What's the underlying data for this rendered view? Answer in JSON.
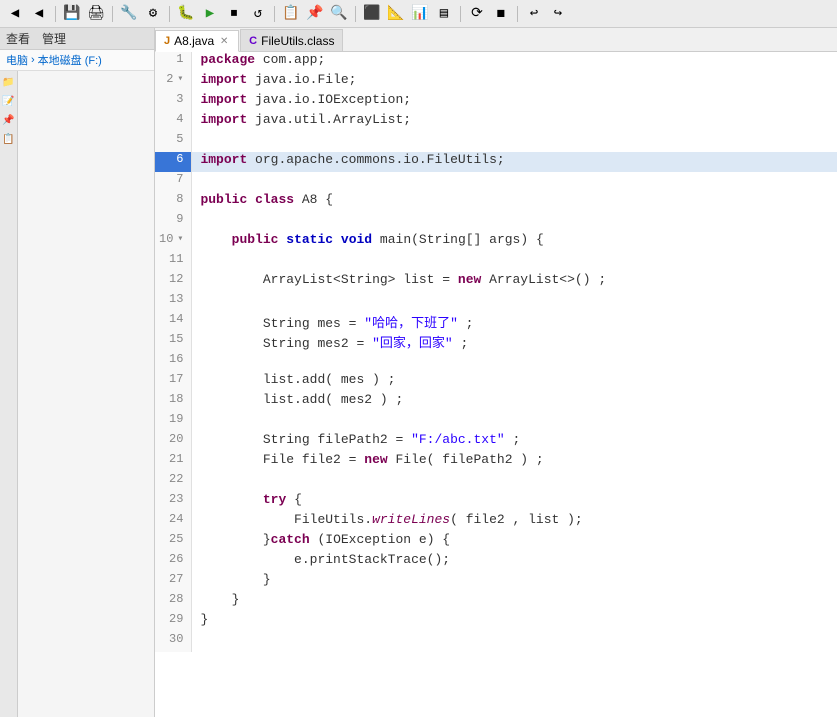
{
  "toolbar": {
    "buttons": [
      "◀",
      "◀◀",
      "💾",
      "🖨",
      "🔧",
      "⚙",
      "🐛",
      "▶",
      "⏹",
      "↺",
      "📋",
      "📌",
      "🔍",
      "⬛",
      "📐",
      "📊",
      "▤",
      "⟳",
      "◼",
      "↩",
      "↪"
    ]
  },
  "left_panel": {
    "menu_items": [
      "查看",
      "管理"
    ],
    "breadcrumb": [
      "电脑",
      "本地磁盘 (F:)"
    ]
  },
  "tabs": [
    {
      "id": "a8",
      "label": "A8.java",
      "icon": "J",
      "active": true,
      "closeable": true
    },
    {
      "id": "fileutils",
      "label": "FileUtils.class",
      "icon": "C",
      "active": false,
      "closeable": false
    }
  ],
  "code_lines": [
    {
      "num": "1",
      "content": "package com.app;",
      "highlighted": false,
      "fold": false,
      "parts": [
        {
          "type": "kw",
          "text": "package"
        },
        {
          "type": "plain",
          "text": " com.app;"
        }
      ]
    },
    {
      "num": "2",
      "content": "import java.io.File;",
      "highlighted": false,
      "fold": true,
      "parts": [
        {
          "type": "kw",
          "text": "import"
        },
        {
          "type": "plain",
          "text": " java.io.File;"
        }
      ]
    },
    {
      "num": "3",
      "content": "import java.io.IOException;",
      "highlighted": false,
      "fold": false,
      "parts": [
        {
          "type": "kw",
          "text": "import"
        },
        {
          "type": "plain",
          "text": " java.io.IOException;"
        }
      ]
    },
    {
      "num": "4",
      "content": "import java.util.ArrayList;",
      "highlighted": false,
      "fold": false,
      "parts": [
        {
          "type": "kw",
          "text": "import"
        },
        {
          "type": "plain",
          "text": " java.util.ArrayList;"
        }
      ]
    },
    {
      "num": "5",
      "content": "",
      "highlighted": false,
      "fold": false,
      "parts": []
    },
    {
      "num": "6",
      "content": "import org.apache.commons.io.FileUtils;",
      "highlighted": true,
      "fold": false,
      "parts": [
        {
          "type": "kw",
          "text": "import"
        },
        {
          "type": "plain",
          "text": " org.apache.commons.io.FileUtils;"
        }
      ]
    },
    {
      "num": "7",
      "content": "",
      "highlighted": false,
      "fold": false,
      "parts": []
    },
    {
      "num": "8",
      "content": "public class A8 {",
      "highlighted": false,
      "fold": false,
      "parts": [
        {
          "type": "kw",
          "text": "public"
        },
        {
          "type": "plain",
          "text": " "
        },
        {
          "type": "kw",
          "text": "class"
        },
        {
          "type": "plain",
          "text": " A8 {"
        }
      ]
    },
    {
      "num": "9",
      "content": "",
      "highlighted": false,
      "fold": false,
      "parts": []
    },
    {
      "num": "10",
      "content": "    public static void main(String[] args) {",
      "highlighted": false,
      "fold": true,
      "parts": [
        {
          "type": "plain",
          "text": "    "
        },
        {
          "type": "kw",
          "text": "public"
        },
        {
          "type": "plain",
          "text": " "
        },
        {
          "type": "kw2",
          "text": "static"
        },
        {
          "type": "plain",
          "text": " "
        },
        {
          "type": "kw2",
          "text": "void"
        },
        {
          "type": "plain",
          "text": " main(String[] args) {"
        }
      ]
    },
    {
      "num": "11",
      "content": "",
      "highlighted": false,
      "fold": false,
      "parts": []
    },
    {
      "num": "12",
      "content": "        ArrayList<String> list = new ArrayList<>();",
      "highlighted": false,
      "fold": false,
      "parts": [
        {
          "type": "plain",
          "text": "        ArrayList<String> list = "
        },
        {
          "type": "kw",
          "text": "new"
        },
        {
          "type": "plain",
          "text": " ArrayList<>() ;"
        }
      ]
    },
    {
      "num": "13",
      "content": "",
      "highlighted": false,
      "fold": false,
      "parts": []
    },
    {
      "num": "14",
      "content": "        String mes = \"哈哈，下班了\" ;",
      "highlighted": false,
      "fold": false,
      "parts": [
        {
          "type": "plain",
          "text": "        String mes = "
        },
        {
          "type": "str",
          "text": "\"哈哈，下班了\""
        },
        {
          "type": "plain",
          "text": " ;"
        }
      ]
    },
    {
      "num": "15",
      "content": "        String mes2 = \"回家，回家\" ;",
      "highlighted": false,
      "fold": false,
      "parts": [
        {
          "type": "plain",
          "text": "        String mes2 = "
        },
        {
          "type": "str",
          "text": "\"回家，回家\""
        },
        {
          "type": "plain",
          "text": " ;"
        }
      ]
    },
    {
      "num": "16",
      "content": "",
      "highlighted": false,
      "fold": false,
      "parts": []
    },
    {
      "num": "17",
      "content": "        list.add( mes ) ;",
      "highlighted": false,
      "fold": false,
      "parts": [
        {
          "type": "plain",
          "text": "        list.add( mes ) ;"
        }
      ]
    },
    {
      "num": "18",
      "content": "        list.add( mes2 ) ;",
      "highlighted": false,
      "fold": false,
      "parts": [
        {
          "type": "plain",
          "text": "        list.add( mes2 ) ;"
        }
      ]
    },
    {
      "num": "19",
      "content": "",
      "highlighted": false,
      "fold": false,
      "parts": []
    },
    {
      "num": "20",
      "content": "        String filePath2 = \"F:/abc.txt\" ;",
      "highlighted": false,
      "fold": false,
      "parts": [
        {
          "type": "plain",
          "text": "        String filePath2 = "
        },
        {
          "type": "str",
          "text": "\"F:/abc.txt\""
        },
        {
          "type": "plain",
          "text": " ;"
        }
      ]
    },
    {
      "num": "21",
      "content": "        File file2 = new File( filePath2 ) ;",
      "highlighted": false,
      "fold": false,
      "parts": [
        {
          "type": "plain",
          "text": "        File file2 = "
        },
        {
          "type": "kw",
          "text": "new"
        },
        {
          "type": "plain",
          "text": " File( filePath2 ) ;"
        }
      ]
    },
    {
      "num": "22",
      "content": "",
      "highlighted": false,
      "fold": false,
      "parts": []
    },
    {
      "num": "23",
      "content": "        try {",
      "highlighted": false,
      "fold": false,
      "parts": [
        {
          "type": "plain",
          "text": "        "
        },
        {
          "type": "kw",
          "text": "try"
        },
        {
          "type": "plain",
          "text": " {"
        }
      ]
    },
    {
      "num": "24",
      "content": "            FileUtils.writeLines( file2 , list );",
      "highlighted": false,
      "fold": false,
      "parts": [
        {
          "type": "plain",
          "text": "            FileUtils."
        },
        {
          "type": "mth",
          "text": "writeLines"
        },
        {
          "type": "plain",
          "text": "( file2 , list );"
        }
      ]
    },
    {
      "num": "25",
      "content": "        }catch (IOException e) {",
      "highlighted": false,
      "fold": false,
      "parts": [
        {
          "type": "plain",
          "text": "        }"
        },
        {
          "type": "kw",
          "text": "catch"
        },
        {
          "type": "plain",
          "text": " (IOException e) {"
        }
      ]
    },
    {
      "num": "26",
      "content": "            e.printStackTrace();",
      "highlighted": false,
      "fold": false,
      "parts": [
        {
          "type": "plain",
          "text": "            e.printStackTrace();"
        }
      ]
    },
    {
      "num": "27",
      "content": "        }",
      "highlighted": false,
      "fold": false,
      "parts": [
        {
          "type": "plain",
          "text": "        }"
        }
      ]
    },
    {
      "num": "28",
      "content": "    }",
      "highlighted": false,
      "fold": false,
      "parts": [
        {
          "type": "plain",
          "text": "    }"
        }
      ]
    },
    {
      "num": "29",
      "content": "}",
      "highlighted": false,
      "fold": false,
      "parts": [
        {
          "type": "plain",
          "text": "}"
        }
      ]
    },
    {
      "num": "30",
      "content": "",
      "highlighted": false,
      "fold": false,
      "parts": []
    }
  ],
  "side_icons": [
    "📁",
    "📝",
    "📌",
    "📋"
  ]
}
